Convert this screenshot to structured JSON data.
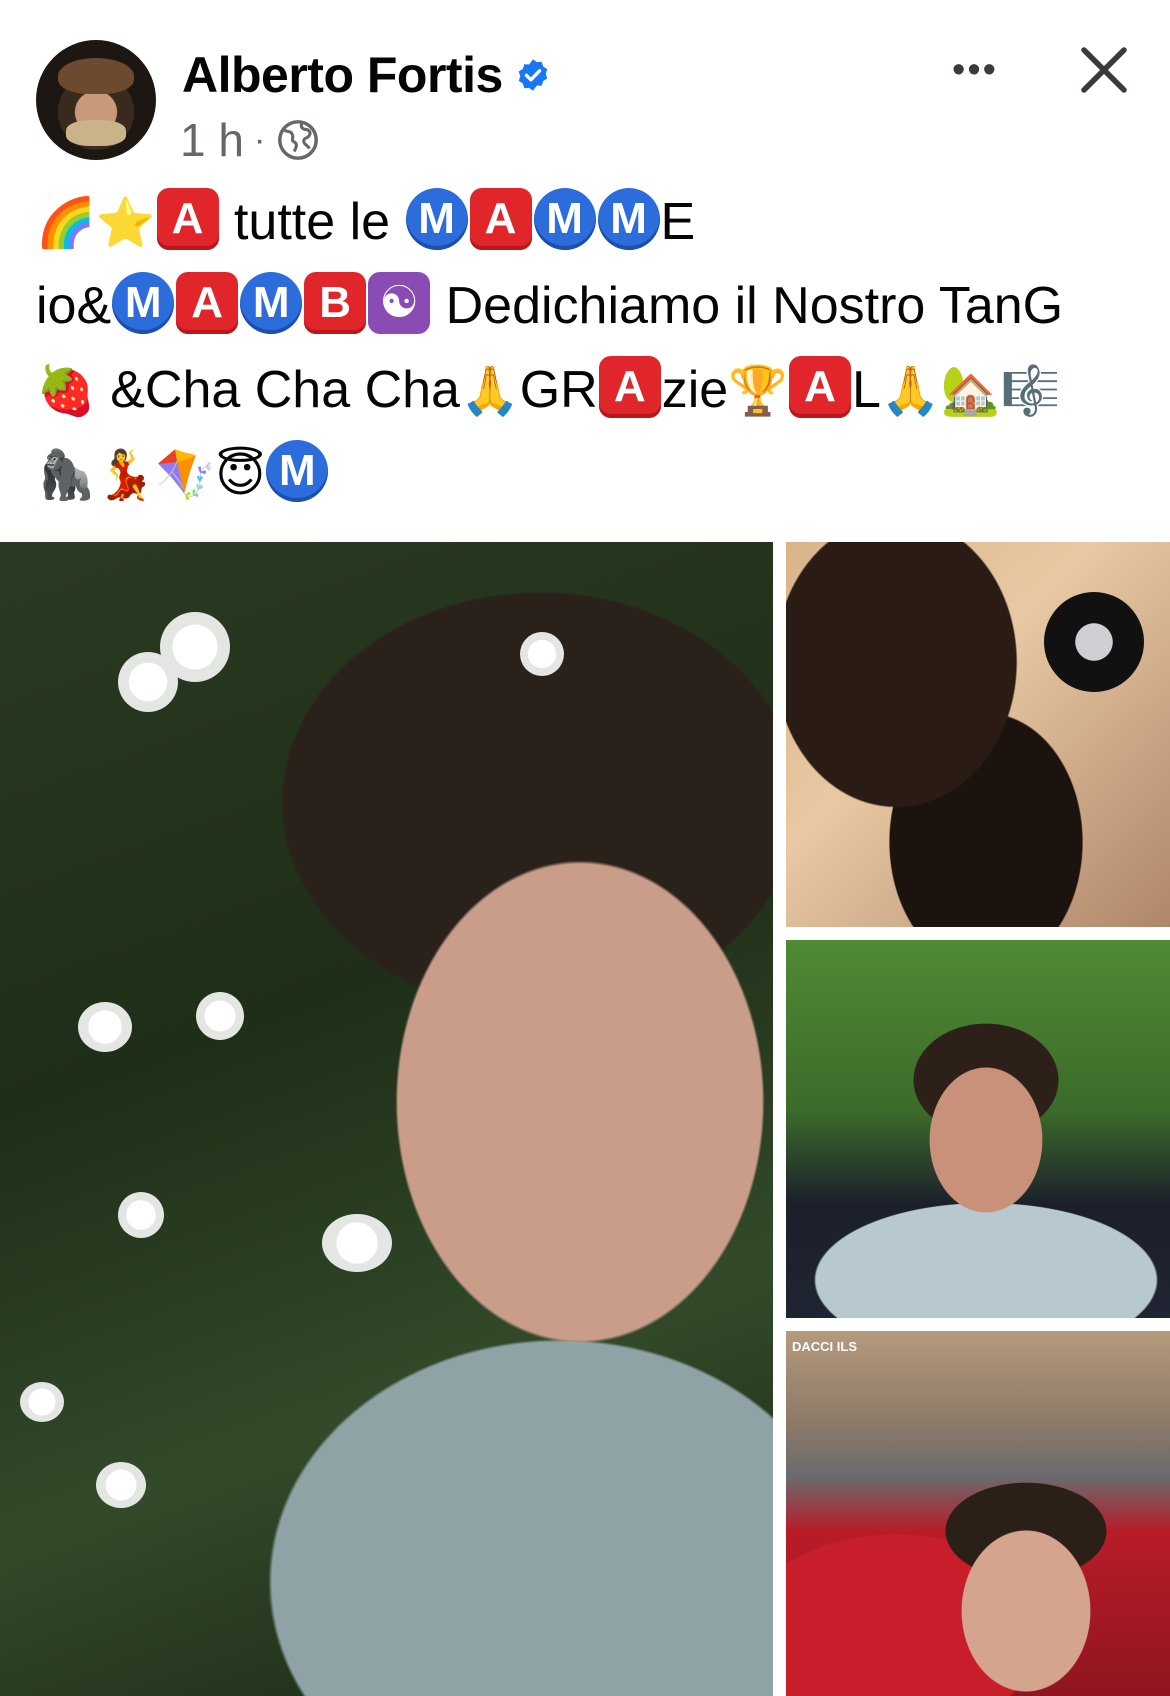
{
  "post": {
    "author": "Alberto Fortis",
    "time": "1 h",
    "separator": "·",
    "more_label": "•••"
  },
  "caption": {
    "line1": [
      {
        "t": "emoji",
        "v": "🌈"
      },
      {
        "t": "emoji",
        "v": "⭐"
      },
      {
        "t": "red",
        "v": "A"
      },
      {
        "t": "text",
        "v": " tutte le "
      },
      {
        "t": "blue",
        "v": "M"
      },
      {
        "t": "red",
        "v": "A"
      },
      {
        "t": "blue",
        "v": "M"
      },
      {
        "t": "blue",
        "v": "M"
      },
      {
        "t": "text",
        "v": "E"
      }
    ],
    "line2": [
      {
        "t": "text",
        "v": "io&"
      },
      {
        "t": "blue",
        "v": "M"
      },
      {
        "t": "red",
        "v": "A"
      },
      {
        "t": "blue",
        "v": "M"
      },
      {
        "t": "red",
        "v": "B"
      },
      {
        "t": "purple",
        "v": "☯"
      },
      {
        "t": "text",
        "v": " Dedichiamo il Nostro TanG"
      }
    ],
    "line3": [
      {
        "t": "emoji",
        "v": "🍓"
      },
      {
        "t": "text",
        "v": " &Cha Cha Cha"
      },
      {
        "t": "emoji",
        "v": "🙏"
      },
      {
        "t": "text",
        "v": "GR"
      },
      {
        "t": "red",
        "v": "A"
      },
      {
        "t": "text",
        "v": "zie"
      },
      {
        "t": "emoji",
        "v": "🏆"
      },
      {
        "t": "red",
        "v": "A"
      },
      {
        "t": "text",
        "v": "L"
      },
      {
        "t": "emoji",
        "v": "🙏"
      },
      {
        "t": "emoji",
        "v": "🏡"
      },
      {
        "t": "emoji",
        "v": "🎼"
      }
    ],
    "line4": [
      {
        "t": "emoji",
        "v": "🦍"
      },
      {
        "t": "emoji",
        "v": "💃"
      },
      {
        "t": "emoji",
        "v": "🪁"
      },
      {
        "t": "emoji",
        "v": "😇"
      },
      {
        "t": "blue",
        "v": "M"
      }
    ]
  },
  "photos": {
    "sign_text": "DACCI ILS"
  },
  "icons": {
    "verified": "verified-badge-icon",
    "globe": "globe-icon",
    "close": "close-icon"
  },
  "colors": {
    "verified_blue": "#1877f2",
    "meta_gray": "#65676b",
    "badge_red": "#e1262b",
    "badge_blue": "#2c6cdb"
  }
}
